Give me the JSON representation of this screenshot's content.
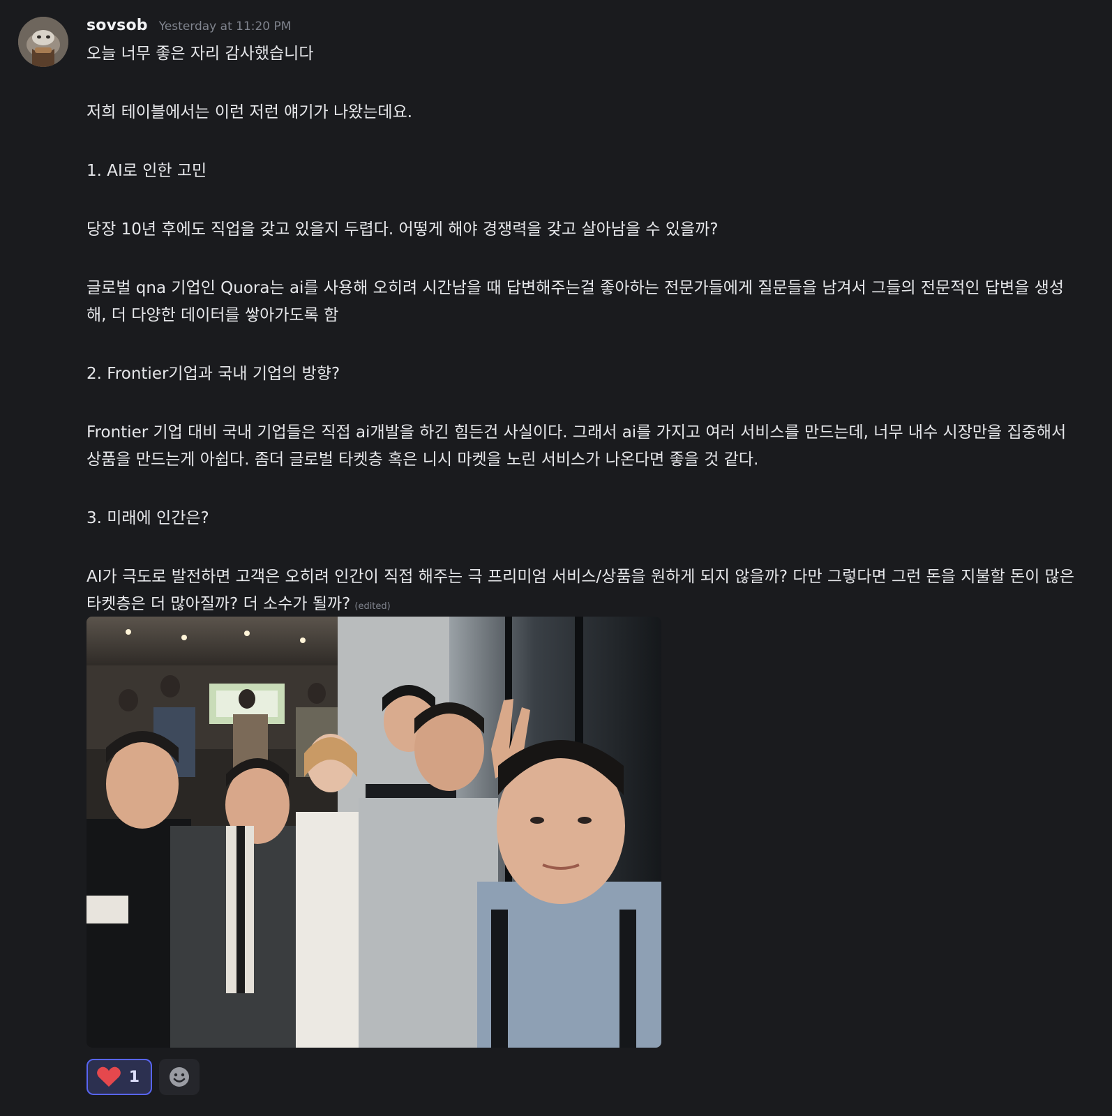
{
  "message": {
    "username": "sovsob",
    "timestamp": "Yesterday at 11:20 PM",
    "edited_label": "(edited)",
    "paragraphs": [
      "오늘 너무 좋은 자리 감사했습니다",
      "저희 테이블에서는 이런 저런 얘기가 나왔는데요.",
      "1. AI로 인한 고민",
      "당장 10년 후에도 직업을 갖고 있을지 두렵다. 어떻게 해야 경쟁력을 갖고 살아남을 수 있을까?",
      "글로벌 qna 기업인 Quora는 ai를 사용해 오히려 시간남을 때 답변해주는걸 좋아하는 전문가들에게 질문들을 남겨서 그들의 전문적인 답변을 생성해, 더 다양한 데이터를 쌓아가도록 함",
      "2. Frontier기업과 국내 기업의 방향?",
      "Frontier 기업 대비 국내 기업들은 직접 ai개발을 하긴 힘든건 사실이다. 그래서 ai를 가지고 여러 서비스를 만드는데, 너무 내수 시장만을 집중해서 상품을 만드는게 아쉽다. 좀더 글로벌 타켓층 혹은 니시 마켓을 노린 서비스가 나온다면 좋을 것 같다.",
      "3. 미래에 인간은?",
      "AI가 극도로 발전하면 고객은 오히려 인간이 직접 해주는 극 프리미엄 서비스/상품을 원하게 되지 않을까? 다만 그렇다면 그런 돈을 지불할 돈이 많은 타켓층은 더 많아질까? 더 소수가 될까?"
    ]
  },
  "reactions": [
    {
      "emoji": "heart-icon",
      "count": "1"
    }
  ],
  "colors": {
    "background": "#1a1b1e",
    "accent": "#5865f2",
    "heart": "#e5484d"
  }
}
